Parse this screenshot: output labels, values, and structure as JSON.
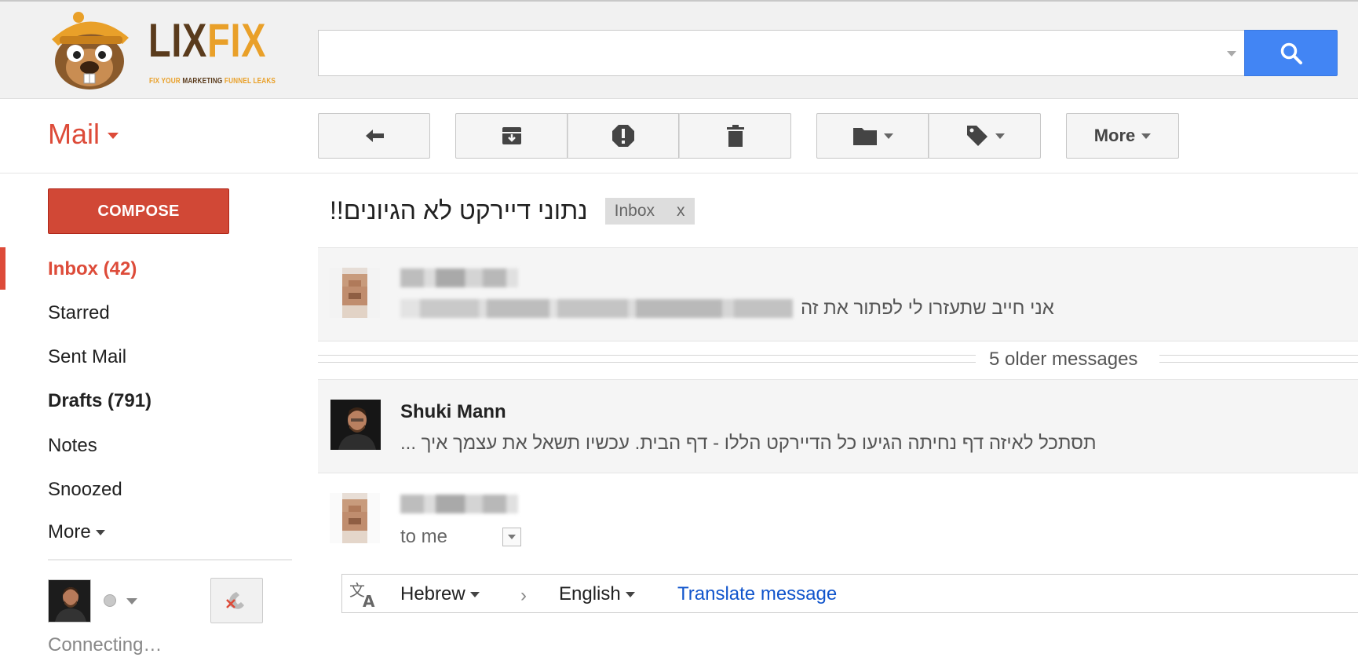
{
  "logo": {
    "word_part1": "LIX",
    "word_part2": "FIX",
    "tagline_a": "FIX YOUR ",
    "tagline_b": "MARKETING",
    "tagline_c": " FUNNEL LEAKS"
  },
  "search": {
    "value": "",
    "placeholder": ""
  },
  "app": {
    "mail_label": "Mail"
  },
  "toolbar": {
    "more_label": "More"
  },
  "compose_label": "COMPOSE",
  "nav": {
    "inbox": "Inbox (42)",
    "starred": "Starred",
    "sent": "Sent Mail",
    "drafts": "Drafts (791)",
    "notes": "Notes",
    "snoozed": "Snoozed",
    "more": "More"
  },
  "hangouts": {
    "status": "Connecting…"
  },
  "thread": {
    "subject": "נתוני דיירקט לא הגיונים!!",
    "label": "Inbox",
    "label_remove": "x",
    "msg1_snippet": "אני חייב שתעזרו לי לפתור את זה",
    "older": "5 older messages",
    "msg2_sender": "Shuki Mann",
    "msg2_snippet": "תסתכל לאיזה דף נחיתה הגיעו כל הדיירקט הללו - דף הבית. עכשיו תשאל את עצמך איך ...",
    "msg3_to": "to me"
  },
  "translate": {
    "from": "Hebrew",
    "arrow": "›",
    "to": "English",
    "link": "Translate message"
  },
  "colors": {
    "accent_red": "#dd4b39",
    "search_blue": "#4285f4",
    "link_blue": "#1155cc"
  }
}
